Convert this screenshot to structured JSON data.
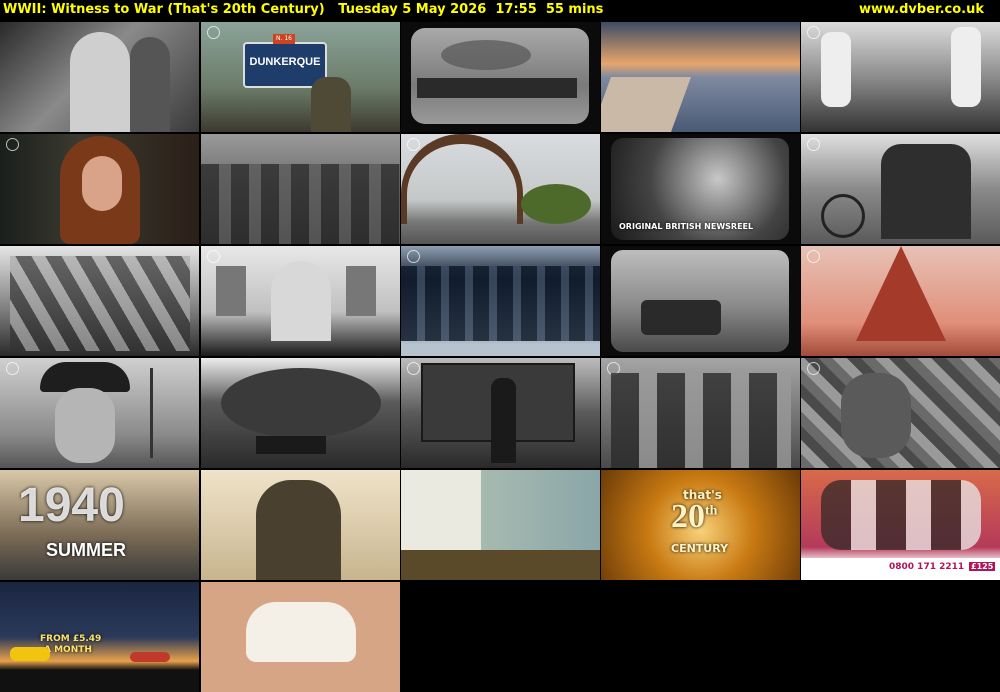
{
  "header": {
    "programme": "WWII: Witness to War (That's 20th Century)",
    "date": "Tuesday 5 May 2026",
    "time": "17:55",
    "duration": "55 mins",
    "site": "www.dvber.co.uk"
  },
  "captions": {
    "dunkerque_sign": "DUNKERQUE",
    "dunkerque_small": "N. 16",
    "newsreel": "ORIGINAL BRITISH NEWSREEL",
    "year": "1940",
    "season": "SUMMER",
    "logo_top": "that's",
    "logo_main": "20",
    "logo_sup": "th",
    "logo_bottom": "CENTURY",
    "ad_phone": "0800 171 2211",
    "ad_price": "£125",
    "ad_price_top": "FROM £5.49",
    "ad_price_bottom": "A MONTH"
  }
}
